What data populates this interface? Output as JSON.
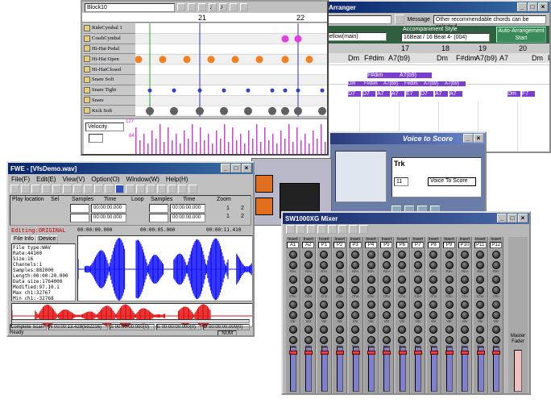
{
  "drum": {
    "block_select": "Block10",
    "bar_markers": [
      "21",
      "22"
    ],
    "tracks": [
      "RideCymbal 1",
      "CrashCymbal",
      "Hi-Hat Pedal",
      "Hi-Hat Open",
      "Hi-HatClosed",
      "Snare Soft",
      "Snare Tight",
      "Snare",
      "Kick Soft"
    ],
    "velocity_label": "Velocity",
    "vel_max": "127",
    "vel_mid": "64"
  },
  "arranger": {
    "title": "Arranger",
    "message_label": "Message",
    "message_text": "Other recommendable chords can be selected.",
    "style_label": "Accompaniment Style",
    "style_value": "16Beat / 16 Beat 4- (004)",
    "voice_value": "Mellow(main)",
    "auto_button": "Auto-Arrangement Start",
    "bar_numbers": [
      "17",
      "18",
      "19",
      "20"
    ],
    "chord_row1": [
      "Dm",
      "F#dim",
      "A7(b9)",
      "Dm",
      "F#dim",
      "A7(b9)",
      "A7",
      "Dm",
      "F7"
    ],
    "chord_row2": [
      "F#dim",
      "A7(b9)"
    ],
    "chord_row3": [
      "Dm",
      "F#dim",
      "A7(b9)",
      "F#dim",
      "A7(b9)",
      "A7(b9)"
    ],
    "chord_row4": [
      "D7",
      "D7",
      "A7",
      "A7",
      "E7",
      "D7",
      "A7",
      "A7",
      "Dm",
      "F7"
    ]
  },
  "voice": {
    "title": "Voice to Score",
    "trk_label": "Trk",
    "trk_value": "11",
    "menu_item": "Voice To Score"
  },
  "fwe": {
    "title": "FWE - [VfsDemo.wav]",
    "menu": [
      "File(F)",
      "Edit(E)",
      "View(V)",
      "Option(O)",
      "Window(W)",
      "Help(H)"
    ],
    "play_location_label": "Play location",
    "sel_label": "Sel",
    "samples_label": "Samples",
    "time_label": "Time",
    "loop_label": "Loop",
    "zoom_label": "Zoom",
    "time_value": "00:00:00.000",
    "zoom_values": [
      "1",
      "2",
      "1",
      "2"
    ],
    "editing_label": "Editing:ORIGINAL",
    "ruler": [
      "00:00:00.000",
      "00:00:05.000",
      "00:00:11.410"
    ],
    "tabs": [
      "File Info",
      "Device"
    ],
    "info_lines": [
      "File type:WAV",
      "Rate:44100",
      "Size:16",
      "Channels:1",
      "Samples:882000",
      "Length:00:00:20.000",
      "Data size:1764000",
      "Modified:97.10.1",
      "Max ch1:32767",
      "Min ch1:-32768"
    ],
    "status": [
      "Complete Scan",
      "N 00:00:13.428(592216)",
      "S 00:00:00.000(0)",
      "E 00:00:00.000(0)",
      "D 00:00:00.000(0)"
    ],
    "status_ready": "Ready",
    "num": "NUM"
  },
  "mixer": {
    "title": "SW1000XG Mixer",
    "insert_label": "Insert",
    "channels": [
      "A1",
      "A2",
      "P1",
      "P2",
      "P3",
      "P4",
      "P5",
      "P6",
      "P7",
      "P8",
      "P9",
      "P10",
      "P11",
      "P12"
    ],
    "knob_labels": [
      "Rev",
      "Cho",
      "Var",
      "Pan"
    ],
    "master_label": "Master Fader"
  },
  "colors": {
    "title_blue": "#0a246a",
    "wave_blue": "#0000ff",
    "wave_red": "#e00000",
    "chord_purple": "#7a3fd0",
    "magenta_dot": "#e040e0",
    "orange_dot": "#f08020",
    "green_line": "#2aa02a",
    "ok_green": "#2f6f3f"
  }
}
